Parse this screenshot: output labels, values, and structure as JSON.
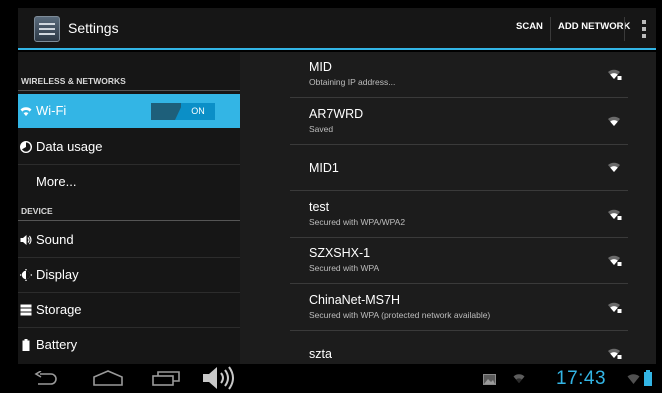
{
  "action_bar": {
    "title": "Settings",
    "scan_label": "SCAN",
    "add_network_label": "ADD NETWORK",
    "icons": [
      "settings-app-icon",
      "overflow-menu-icon"
    ]
  },
  "sidebar": {
    "sections": [
      {
        "label": "WIRELESS & NETWORKS"
      },
      {
        "label": "DEVICE"
      }
    ],
    "items": [
      {
        "label": "Wi-Fi",
        "icon": "wifi-icon",
        "toggle": "ON",
        "selected": true
      },
      {
        "label": "Data usage",
        "icon": "data-usage-icon"
      },
      {
        "label": "More..."
      },
      {
        "label": "Sound",
        "icon": "sound-icon"
      },
      {
        "label": "Display",
        "icon": "display-icon"
      },
      {
        "label": "Storage",
        "icon": "storage-icon"
      },
      {
        "label": "Battery",
        "icon": "battery-icon"
      }
    ]
  },
  "networks": [
    {
      "name": "MID",
      "status": "Obtaining IP address...",
      "secured": true
    },
    {
      "name": "AR7WRD",
      "status": "Saved",
      "secured": false
    },
    {
      "name": "MID1",
      "status": "",
      "secured": false
    },
    {
      "name": "test",
      "status": "Secured with WPA/WPA2",
      "secured": true
    },
    {
      "name": "SZXSHX-1",
      "status": "Secured with WPA",
      "secured": true
    },
    {
      "name": "ChinaNet-MS7H",
      "status": "Secured with WPA (protected network available)",
      "secured": true
    },
    {
      "name": "szta",
      "status": "",
      "secured": true
    }
  ],
  "nav_bar": {
    "icons": [
      "back-icon",
      "home-icon",
      "recent-apps-icon",
      "volume-icon",
      "gallery-notification-icon",
      "wifi-notification-icon",
      "wifi-status-icon",
      "battery-status-icon"
    ],
    "time": "17:43"
  },
  "colors": {
    "accent": "#33b5e5",
    "panel": "#161616",
    "background": "#000000"
  }
}
